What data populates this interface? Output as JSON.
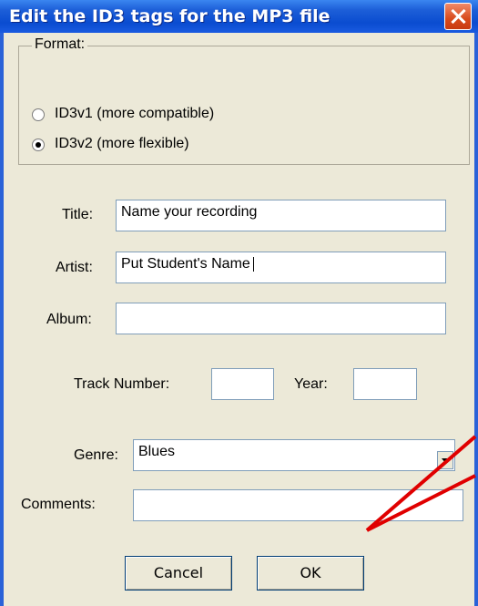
{
  "dialog": {
    "title": "Edit the ID3 tags for the MP3 file",
    "format_label": "Format:",
    "options": [
      {
        "label": "ID3v1 (more compatible)",
        "checked": false
      },
      {
        "label": "ID3v2 (more flexible)",
        "checked": true
      }
    ],
    "fields": {
      "title_label": "Title:",
      "title_value": "Name your recording",
      "artist_label": "Artist:",
      "artist_value": "Put Student's Name",
      "album_label": "Album:",
      "album_value": "",
      "track_label": "Track Number:",
      "track_value": "",
      "year_label": "Year:",
      "year_value": "",
      "genre_label": "Genre:",
      "genre_value": "Blues",
      "comments_label": "Comments:",
      "comments_value": ""
    },
    "buttons": {
      "cancel": "Cancel",
      "ok": "OK"
    }
  },
  "colors": {
    "annotation_arrow": "#e00000",
    "titlebar": "#0a4cd0",
    "dialog_bg": "#ece9d8"
  }
}
